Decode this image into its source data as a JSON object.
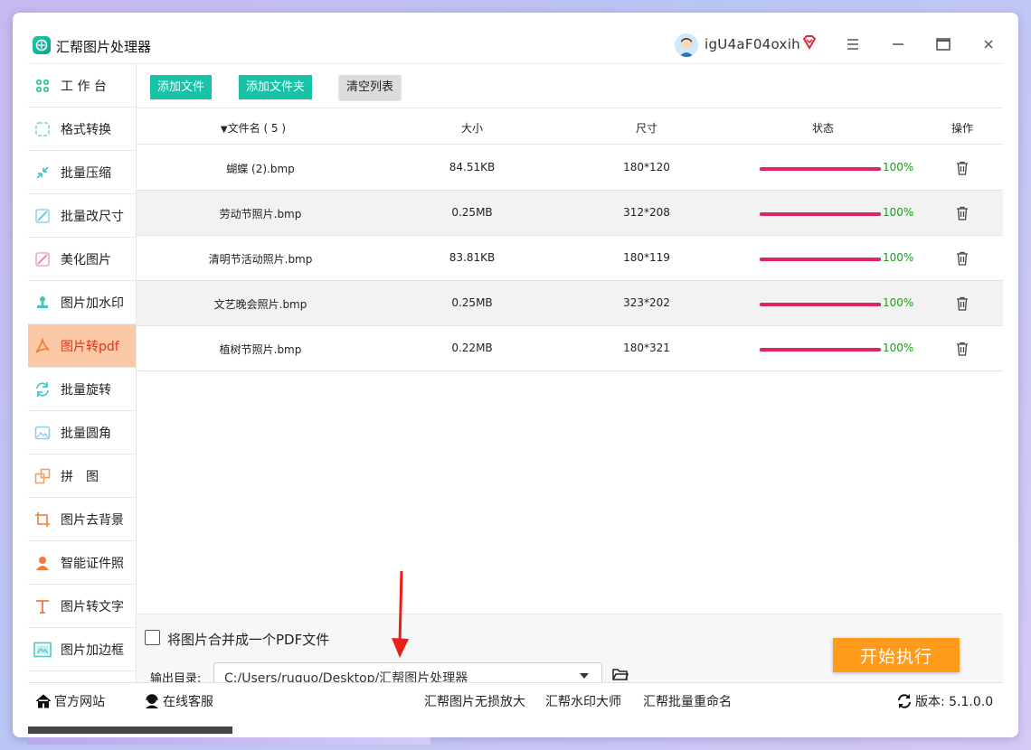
{
  "app": {
    "title": "汇帮图片处理器",
    "username": "igU4aF04oxih"
  },
  "sidebar": {
    "items": [
      {
        "label": "工 作 台",
        "icon": "dashboard-icon"
      },
      {
        "label": "格式转换",
        "icon": "format-convert-icon"
      },
      {
        "label": "批量压缩",
        "icon": "compress-icon"
      },
      {
        "label": "批量改尺寸",
        "icon": "resize-icon"
      },
      {
        "label": "美化图片",
        "icon": "beautify-icon"
      },
      {
        "label": "图片加水印",
        "icon": "watermark-icon"
      },
      {
        "label": "图片转pdf",
        "icon": "pdf-icon",
        "active": true
      },
      {
        "label": "批量旋转",
        "icon": "rotate-icon"
      },
      {
        "label": "批量圆角",
        "icon": "rounded-corner-icon"
      },
      {
        "label": "拼　图",
        "icon": "collage-icon"
      },
      {
        "label": "图片去背景",
        "icon": "crop-icon"
      },
      {
        "label": "智能证件照",
        "icon": "id-photo-icon"
      },
      {
        "label": "图片转文字",
        "icon": "text-icon"
      },
      {
        "label": "图片加边框",
        "icon": "frame-icon"
      }
    ]
  },
  "toolbar": {
    "add_files": "添加文件",
    "add_folder": "添加文件夹",
    "clear_list": "清空列表"
  },
  "table": {
    "headers": {
      "filename": "文件名 ( 5 )",
      "size": "大小",
      "dimensions": "尺寸",
      "status": "状态",
      "actions": "操作"
    },
    "rows": [
      {
        "name": "蝴蝶 (2).bmp",
        "size": "84.51KB",
        "dims": "180*120",
        "progress": 1.0,
        "status": "100%"
      },
      {
        "name": "劳动节照片.bmp",
        "size": "0.25MB",
        "dims": "312*208",
        "progress": 1.0,
        "status": "100%"
      },
      {
        "name": "清明节活动照片.bmp",
        "size": "83.81KB",
        "dims": "180*119",
        "progress": 1.0,
        "status": "100%"
      },
      {
        "name": "文艺晚会照片.bmp",
        "size": "0.25MB",
        "dims": "323*202",
        "progress": 1.0,
        "status": "100%"
      },
      {
        "name": "植树节照片.bmp",
        "size": "0.22MB",
        "dims": "180*321",
        "progress": 1.0,
        "status": "100%"
      }
    ]
  },
  "options": {
    "merge_label": "将图片合并成一个PDF文件",
    "merge_checked": false,
    "output_label": "输出目录:",
    "output_path": "C:/Users/ruguo/Desktop/汇帮图片处理器",
    "start_button": "开始执行"
  },
  "footer": {
    "official_site": "官方网站",
    "online_service": "在线客服",
    "link1": "汇帮图片无损放大",
    "link2": "汇帮水印大师",
    "link3": "汇帮批量重命名",
    "version": "版本:  5.1.0.0"
  },
  "colors": {
    "teal": "#18c2a6",
    "active_bg": "#fbc9a6",
    "active_text": "#e0321c",
    "progress": "#e0245e",
    "status_green": "#1a9e1a",
    "start_orange": "#ff9a1a"
  }
}
